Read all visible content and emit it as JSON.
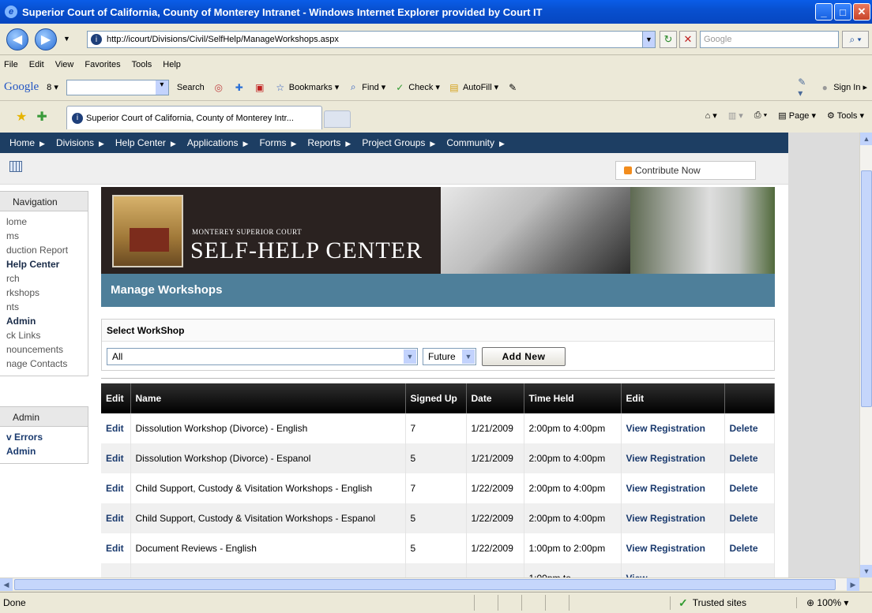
{
  "window": {
    "title": "Superior Court of California, County of Monterey Intranet - Windows Internet Explorer provided by Court IT",
    "url": "http://icourt/Divisions/Civil/SelfHelp/ManageWorkshops.aspx",
    "search_placeholder": "Google"
  },
  "menu": [
    "File",
    "Edit",
    "View",
    "Favorites",
    "Tools",
    "Help"
  ],
  "google_toolbar": {
    "logo": "Google",
    "g_label": "8 ▾",
    "search": "Search",
    "bookmarks": "Bookmarks",
    "find": "Find",
    "check": "Check",
    "autofill": "AutoFill",
    "sign_in": "Sign In"
  },
  "tab": {
    "title": "Superior Court of California, County of Monterey Intr...",
    "cmd_page": "Page",
    "cmd_tools": "Tools"
  },
  "site_nav": [
    "Home",
    "Divisions",
    "Help Center",
    "Applications",
    "Forms",
    "Reports",
    "Project Groups",
    "Community"
  ],
  "contribute": "Contribute Now",
  "left_nav": {
    "header": "Navigation",
    "items": [
      {
        "label": "lome",
        "bold": false
      },
      {
        "label": "ms",
        "bold": false
      },
      {
        "label": "duction Report",
        "bold": false
      },
      {
        "label": "Help Center",
        "bold": true
      },
      {
        "label": "rch",
        "bold": false
      },
      {
        "label": "rkshops",
        "bold": false
      },
      {
        "label": "nts",
        "bold": false
      },
      {
        "label": "Admin",
        "bold": true
      },
      {
        "label": "ck Links",
        "bold": false
      },
      {
        "label": "nouncements",
        "bold": false
      },
      {
        "label": "nage Contacts",
        "bold": false
      }
    ],
    "header2": "Admin",
    "items2": [
      "v Errors",
      "Admin"
    ]
  },
  "banner": {
    "small": "MONTEREY SUPERIOR COURT",
    "big": "SELF-HELP CENTER"
  },
  "page_title": "Manage Workshops",
  "select": {
    "title": "Select WorkShop",
    "workshop_value": "All",
    "filter_value": "Future",
    "add_new": "Add New"
  },
  "table": {
    "headers": [
      "Edit",
      "Name",
      "Signed Up",
      "Date",
      "Time Held",
      "Edit",
      ""
    ],
    "rows": [
      {
        "edit": "Edit",
        "name": "Dissolution Workshop (Divorce) - English",
        "signed": "7",
        "date": "1/21/2009",
        "time": "2:00pm to 4:00pm",
        "view": "View Registration",
        "delete": "Delete"
      },
      {
        "edit": "Edit",
        "name": "Dissolution Workshop (Divorce) - Espanol",
        "signed": "5",
        "date": "1/21/2009",
        "time": "2:00pm to 4:00pm",
        "view": "View Registration",
        "delete": "Delete"
      },
      {
        "edit": "Edit",
        "name": "Child Support, Custody & Visitation Workshops - English",
        "signed": "7",
        "date": "1/22/2009",
        "time": "2:00pm to 4:00pm",
        "view": "View Registration",
        "delete": "Delete"
      },
      {
        "edit": "Edit",
        "name": "Child Support, Custody & Visitation Workshops - Espanol",
        "signed": "5",
        "date": "1/22/2009",
        "time": "2:00pm to 4:00pm",
        "view": "View Registration",
        "delete": "Delete"
      },
      {
        "edit": "Edit",
        "name": "Document Reviews - English",
        "signed": "5",
        "date": "1/22/2009",
        "time": "1:00pm to 2:00pm",
        "view": "View Registration",
        "delete": "Delete"
      },
      {
        "edit": "",
        "name": "",
        "signed": "",
        "date": "",
        "time": "1:00pm to",
        "view": "View",
        "delete": ""
      }
    ]
  },
  "status": {
    "text": "Done",
    "zone": "Trusted sites",
    "zoom": "100%"
  }
}
